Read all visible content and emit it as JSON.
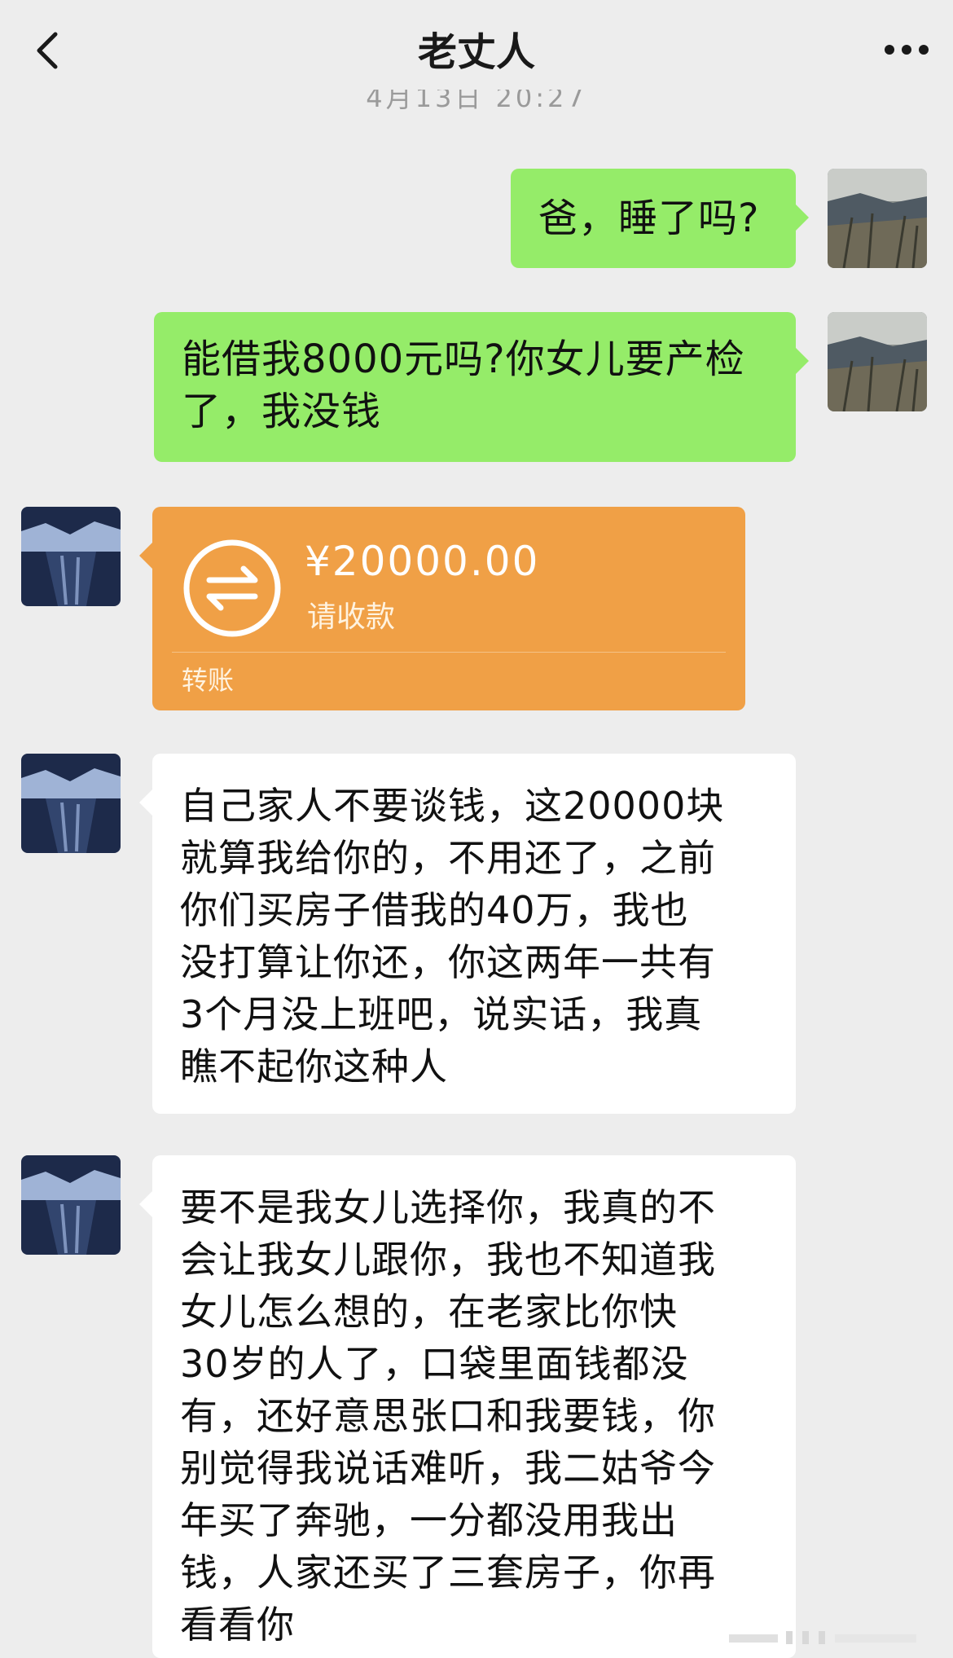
{
  "header": {
    "title": "老丈人",
    "back_icon": "chevron-left-icon",
    "more_icon": "more-dots-icon"
  },
  "timestamp": "4月13日 20:27",
  "messages": [
    {
      "side": "right",
      "type": "text",
      "text": "爸，睡了吗?"
    },
    {
      "side": "right",
      "type": "text",
      "text": "能借我8000元吗?你女儿要产检了，我没钱"
    },
    {
      "side": "left",
      "type": "transfer",
      "amount": "¥20000.00",
      "note": "请收款",
      "label": "转账"
    },
    {
      "side": "left",
      "type": "text",
      "lines": [
        "自己家人不要谈钱，这20000块",
        "就算我给你的，不用还了，之前",
        "你们买房子借我的40万，我也",
        "没打算让你还，你这两年一共有",
        "3个月没上班吧，说实话，我真",
        "瞧不起你这种人"
      ]
    },
    {
      "side": "left",
      "type": "text",
      "lines": [
        "要不是我女儿选择你，我真的不",
        "会让我女儿跟你，我也不知道我",
        "女儿怎么想的，在老家比你快",
        "30岁的人了，口袋里面钱都没",
        "有，还好意思张口和我要钱，你",
        "别觉得我说话难听，我二姑爷今",
        "年买了奔驰，一分都没用我出",
        "钱，人家还买了三套房子，你再",
        "看看你"
      ]
    }
  ],
  "colors": {
    "background": "#ededed",
    "self_bubble": "#95ec69",
    "other_bubble": "#ffffff",
    "transfer_card": "#f0a046"
  }
}
